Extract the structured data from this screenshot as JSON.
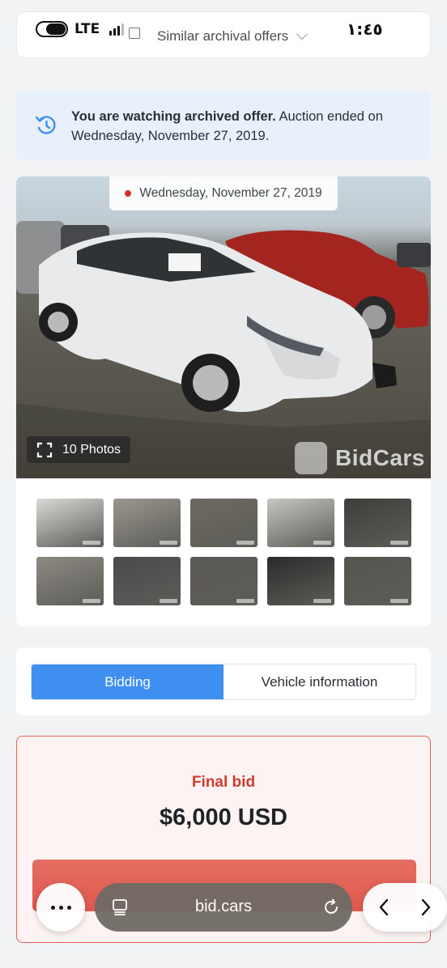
{
  "status_bar": {
    "network": "LTE",
    "time": "١:٤٥"
  },
  "header": {
    "similar_offers_label": "Similar archival offers"
  },
  "notice": {
    "bold_text": "You are watching archived offer.",
    "rest_text": " Auction ended on Wednesday, November 27, 2019."
  },
  "gallery": {
    "date_label": "Wednesday, November 27, 2019",
    "photos_count_label": "10 Photos",
    "brand_label": "BidCars",
    "thumbnail_colors": [
      "#d9d9d6",
      "#9a9790",
      "#6d6a62",
      "#c8c6c0",
      "#3e3d3a",
      "#8d8a84",
      "#4a4a4e",
      "#5a5956",
      "#2b2b2b",
      "#55544f"
    ]
  },
  "tabs": {
    "bidding": "Bidding",
    "vehicle_information": "Vehicle information",
    "active": "bidding"
  },
  "bid": {
    "label": "Final bid",
    "amount": "$6,000 USD"
  },
  "browser": {
    "url": "bid.cars"
  },
  "colors": {
    "accent_blue": "#3f8ff0",
    "notice_bg": "#e8f1fb",
    "bid_red": "#d13a30",
    "bid_bg": "#fdf3f2"
  }
}
